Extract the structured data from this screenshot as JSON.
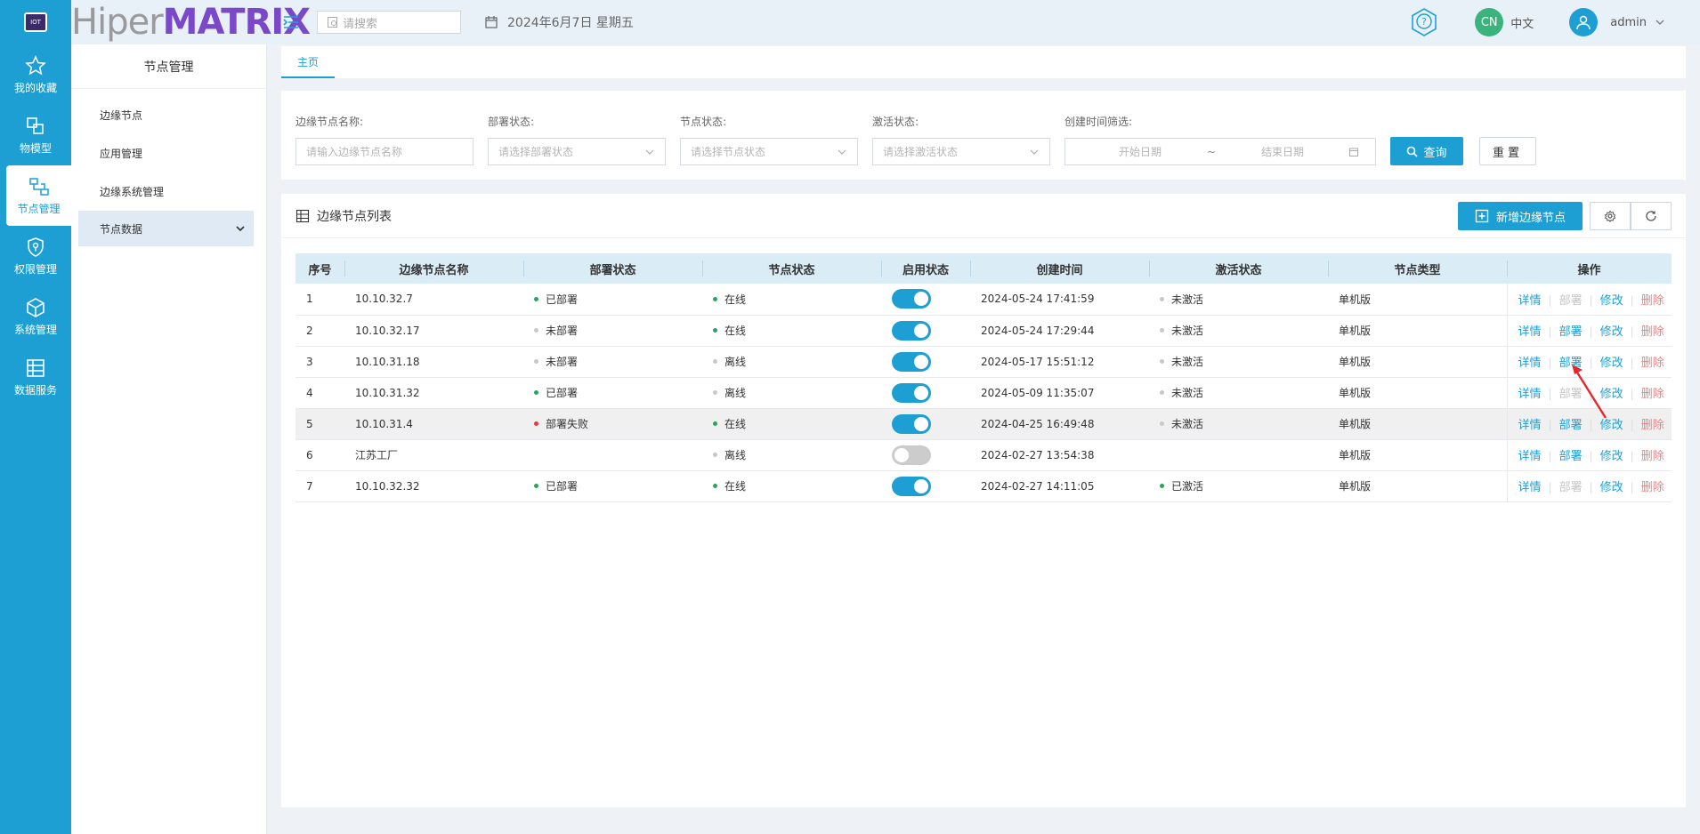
{
  "rail": {
    "items": [
      {
        "label": "我的收藏",
        "icon": "star-icon"
      },
      {
        "label": "物模型",
        "icon": "model-icon"
      },
      {
        "label": "节点管理",
        "icon": "node-icon"
      },
      {
        "label": "权限管理",
        "icon": "shield-icon"
      },
      {
        "label": "系统管理",
        "icon": "cube-icon"
      },
      {
        "label": "数据服务",
        "icon": "data-icon"
      }
    ]
  },
  "header": {
    "brand_part1": "Hiper",
    "brand_part2": "MATRIX",
    "search_placeholder": "请搜索",
    "date": "2024年6月7日 星期五",
    "lang_badge": "CN",
    "lang_label": "中文",
    "user": "admin"
  },
  "subnav": {
    "title": "节点管理",
    "items": [
      "边缘节点",
      "应用管理",
      "边缘系统管理",
      "节点数据"
    ]
  },
  "tabs": [
    "主页"
  ],
  "filters": {
    "name_label": "边缘节点名称:",
    "name_placeholder": "请输入边缘节点名称",
    "deploy_label": "部署状态:",
    "deploy_placeholder": "请选择部署状态",
    "node_label": "节点状态:",
    "node_placeholder": "请选择节点状态",
    "activate_label": "激活状态:",
    "activate_placeholder": "请选择激活状态",
    "time_label": "创建时间筛选:",
    "start_placeholder": "开始日期",
    "range_sep": "~",
    "end_placeholder": "结束日期",
    "query_label": "查询",
    "reset_label": "重置"
  },
  "panel": {
    "title": "边缘节点列表",
    "add_label": "新增边缘节点"
  },
  "table": {
    "columns": [
      "序号",
      "边缘节点名称",
      "部署状态",
      "节点状态",
      "启用状态",
      "创建时间",
      "激活状态",
      "节点类型",
      "操作"
    ],
    "ops": {
      "detail": "详情",
      "deploy": "部署",
      "edit": "修改",
      "delete": "删除"
    },
    "rows": [
      {
        "no": "1",
        "name": "10.10.32.7",
        "deploy": "已部署",
        "deploy_color": "green",
        "node": "在线",
        "node_color": "green",
        "enabled": true,
        "time": "2024-05-24 17:41:59",
        "activate": "未激活",
        "activate_color": "gray",
        "type": "单机版",
        "deploy_disabled": true,
        "highlight": false
      },
      {
        "no": "2",
        "name": "10.10.32.17",
        "deploy": "未部署",
        "deploy_color": "gray",
        "node": "在线",
        "node_color": "green",
        "enabled": true,
        "time": "2024-05-24 17:29:44",
        "activate": "未激活",
        "activate_color": "gray",
        "type": "单机版",
        "deploy_disabled": false,
        "highlight": false
      },
      {
        "no": "3",
        "name": "10.10.31.18",
        "deploy": "未部署",
        "deploy_color": "gray",
        "node": "离线",
        "node_color": "gray",
        "enabled": true,
        "time": "2024-05-17 15:51:12",
        "activate": "未激活",
        "activate_color": "gray",
        "type": "单机版",
        "deploy_disabled": false,
        "highlight": false
      },
      {
        "no": "4",
        "name": "10.10.31.32",
        "deploy": "已部署",
        "deploy_color": "green",
        "node": "离线",
        "node_color": "gray",
        "enabled": true,
        "time": "2024-05-09 11:35:07",
        "activate": "未激活",
        "activate_color": "gray",
        "type": "单机版",
        "deploy_disabled": true,
        "highlight": false
      },
      {
        "no": "5",
        "name": "10.10.31.4",
        "deploy": "部署失败",
        "deploy_color": "red",
        "node": "在线",
        "node_color": "green",
        "enabled": true,
        "time": "2024-04-25 16:49:48",
        "activate": "未激活",
        "activate_color": "gray",
        "type": "单机版",
        "deploy_disabled": false,
        "highlight": true
      },
      {
        "no": "6",
        "name": "江苏工厂",
        "deploy": "",
        "deploy_color": "",
        "node": "离线",
        "node_color": "gray",
        "enabled": false,
        "time": "2024-02-27 13:54:38",
        "activate": "",
        "activate_color": "",
        "type": "单机版",
        "deploy_disabled": false,
        "highlight": false
      },
      {
        "no": "7",
        "name": "10.10.32.32",
        "deploy": "已部署",
        "deploy_color": "green",
        "node": "在线",
        "node_color": "green",
        "enabled": true,
        "time": "2024-02-27 14:11:05",
        "activate": "已激活",
        "activate_color": "green",
        "type": "单机版",
        "deploy_disabled": true,
        "highlight": false
      }
    ]
  },
  "colors": {
    "accent": "#1e9fd4",
    "brand_purple": "#7a48c8",
    "delete": "#f08080",
    "arrow": "#e8262b"
  }
}
